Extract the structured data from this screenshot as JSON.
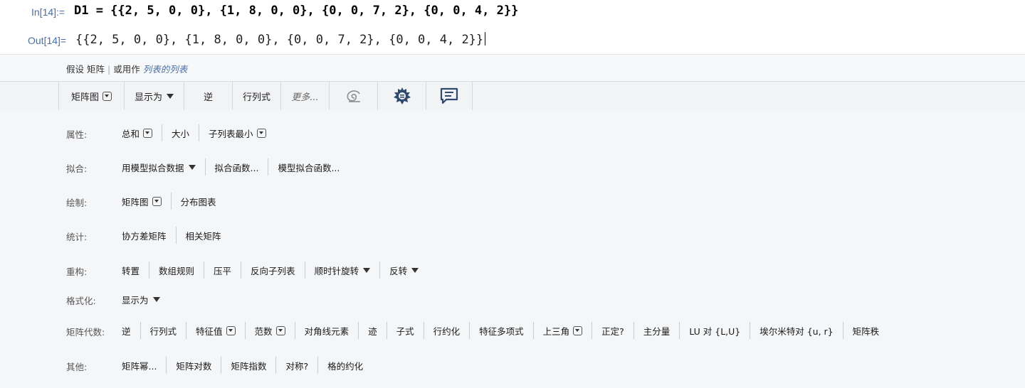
{
  "notebook": {
    "in_label": "In[14]:=",
    "in_code": "D1 = {{2, 5, 0, 0}, {1, 8, 0, 0}, {0, 0, 7, 2}, {0, 0, 4, 2}}",
    "out_label": "Out[14]=",
    "out_code": "{{2, 5, 0, 0}, {1, 8, 0, 0}, {0, 0, 7, 2}, {0, 0, 4, 2}}"
  },
  "assumption": {
    "prefix": "假设 矩阵",
    "separator": "|",
    "middle": "或用作",
    "alternative": "列表的列表"
  },
  "toolbar": {
    "matrix_plot": "矩阵图",
    "display_as": "显示为",
    "inverse": "逆",
    "determinant": "行列式",
    "more": "更多..."
  },
  "panel": {
    "rows": [
      {
        "label": "属性:",
        "items": [
          "总和",
          "大小",
          "子列表最小"
        ]
      },
      {
        "label": "拟合:",
        "items": [
          "用模型拟合数据",
          "拟合函数...",
          "模型拟合函数..."
        ]
      },
      {
        "label": "绘制:",
        "items": [
          "矩阵图",
          "分布图表"
        ]
      },
      {
        "label": "统计:",
        "items": [
          "协方差矩阵",
          "相关矩阵"
        ]
      },
      {
        "label": "重构:",
        "items": [
          "转置",
          "数组规则",
          "压平",
          "反向子列表",
          "顺时针旋转",
          "反转"
        ]
      },
      {
        "label": "格式化:",
        "items": [
          "显示为"
        ]
      },
      {
        "label": "矩阵代数:",
        "items": [
          "逆",
          "行列式",
          "特征值",
          "范数",
          "对角线元素",
          "迹",
          "子式",
          "行约化",
          "特征多项式",
          "上三角",
          "正定?",
          "主分量",
          "LU 对 {L,U}",
          "埃尔米特对 {u, r}",
          "矩阵秩"
        ]
      },
      {
        "label": "其他:",
        "items": [
          "矩阵幂...",
          "矩阵对数",
          "矩阵指数",
          "对称?",
          "格的约化"
        ]
      }
    ]
  }
}
